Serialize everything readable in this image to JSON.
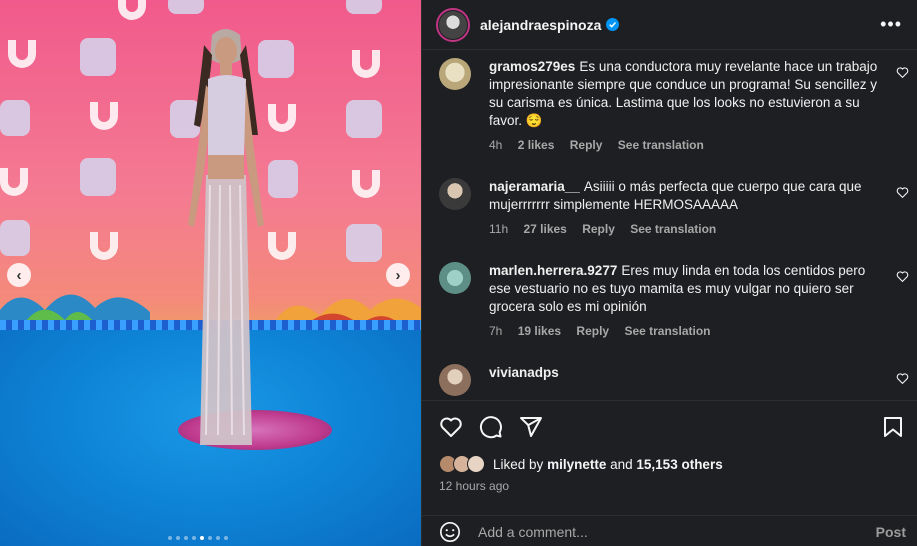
{
  "post": {
    "author": "alejandraespinoza",
    "verified": true,
    "liked_by_text": "Liked by",
    "liked_by_user": "milynette",
    "and_text": "and",
    "others_count": "15,153 others",
    "posted": "12 hours ago",
    "carousel": {
      "total": 8,
      "active_index": 4
    }
  },
  "comments": [
    {
      "username": "gramos279es",
      "text": "Es una conductora muy revelante hace un trabajo impresionante siempre que conduce un programa! Su sencillez y su carisma es única. Lastima que los looks no estuvieron a su favor. 😌",
      "time": "4h",
      "likes": "2 likes",
      "reply": "Reply",
      "translate": "See translation"
    },
    {
      "username": "najeramaria__",
      "text": "Asiiiii o más perfecta que cuerpo que cara que mujerrrrrrr simplemente HERMOSAAAAA",
      "time": "11h",
      "likes": "27 likes",
      "reply": "Reply",
      "translate": "See translation"
    },
    {
      "username": "marlen.herrera.9277",
      "text": "Eres muy linda en toda los centidos pero ese vestuario no es tuyo mamita es muy vulgar no quiero ser grocera solo es mi opinión",
      "time": "7h",
      "likes": "19 likes",
      "reply": "Reply",
      "translate": "See translation"
    },
    {
      "username": "vivianadps",
      "text": ""
    }
  ],
  "add_comment": {
    "placeholder": "Add a comment...",
    "post_label": "Post"
  },
  "colors": {
    "panel_bg": "#1e1f22",
    "verified": "#0095f6",
    "muted": "#a8a8a8"
  },
  "icons": [
    "heart-icon",
    "comment-icon",
    "share-icon",
    "bookmark-icon",
    "emoji-icon",
    "more-icon",
    "chevron-left-icon",
    "chevron-right-icon"
  ]
}
